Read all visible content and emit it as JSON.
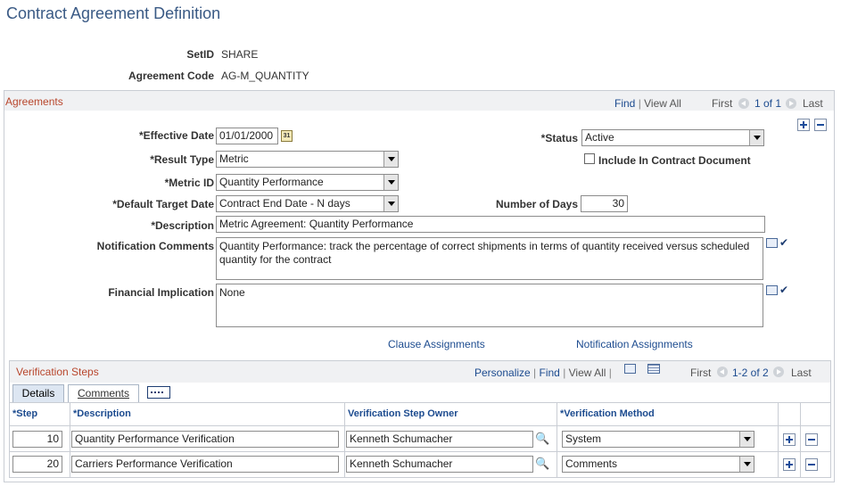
{
  "page": {
    "title": "Contract Agreement Definition"
  },
  "header": {
    "setid_label": "SetID",
    "setid_value": "SHARE",
    "agreement_code_label": "Agreement Code",
    "agreement_code_value": "AG-M_QUANTITY"
  },
  "agreements": {
    "title": "Agreements",
    "find": "Find",
    "view_all": "View All",
    "first": "First",
    "paging": "1 of 1",
    "last": "Last",
    "effective_date_label": "*Effective Date",
    "effective_date": "01/01/2000",
    "status_label": "*Status",
    "status": "Active",
    "result_type_label": "*Result Type",
    "result_type": "Metric",
    "include_label": "Include In Contract Document",
    "metric_id_label": "*Metric ID",
    "metric_id": "Quantity Performance",
    "default_target_label": "*Default Target Date",
    "default_target": "Contract End Date - N days",
    "number_of_days_label": "Number of Days",
    "number_of_days": "30",
    "description_label": "*Description",
    "description": "Metric Agreement: Quantity Performance",
    "notification_comments_label": "Notification Comments",
    "notification_comments": "Quantity Performance: track the percentage of correct shipments in terms of quantity received versus scheduled quantity for the contract",
    "financial_implication_label": "Financial Implication",
    "financial_implication": "None",
    "clause_assignments": "Clause Assignments",
    "notification_assignments": "Notification Assignments"
  },
  "verification": {
    "title": "Verification Steps",
    "personalize": "Personalize",
    "find": "Find",
    "view_all": "View All",
    "first": "First",
    "paging": "1-2 of 2",
    "last": "Last",
    "tabs": [
      "Details",
      "Comments"
    ],
    "columns": [
      "*Step",
      "*Description",
      "Verification Step Owner",
      "*Verification Method"
    ],
    "rows": [
      {
        "step": "10",
        "description": "Quantity Performance Verification",
        "owner": "Kenneth Schumacher",
        "method": "System"
      },
      {
        "step": "20",
        "description": "Carriers Performance Verification",
        "owner": "Kenneth Schumacher",
        "method": "Comments"
      }
    ]
  },
  "icons": {
    "calendar": "calendar-icon",
    "spellcheck": "spellcheck-icon",
    "expand": "expand-text-icon",
    "lookup": "magnifier-icon",
    "add": "plus-icon",
    "remove": "minus-icon",
    "grid": "grid-icon"
  },
  "colors": {
    "title": "#3a5a85",
    "section": "#b8462c",
    "link": "#1c4b8f"
  }
}
